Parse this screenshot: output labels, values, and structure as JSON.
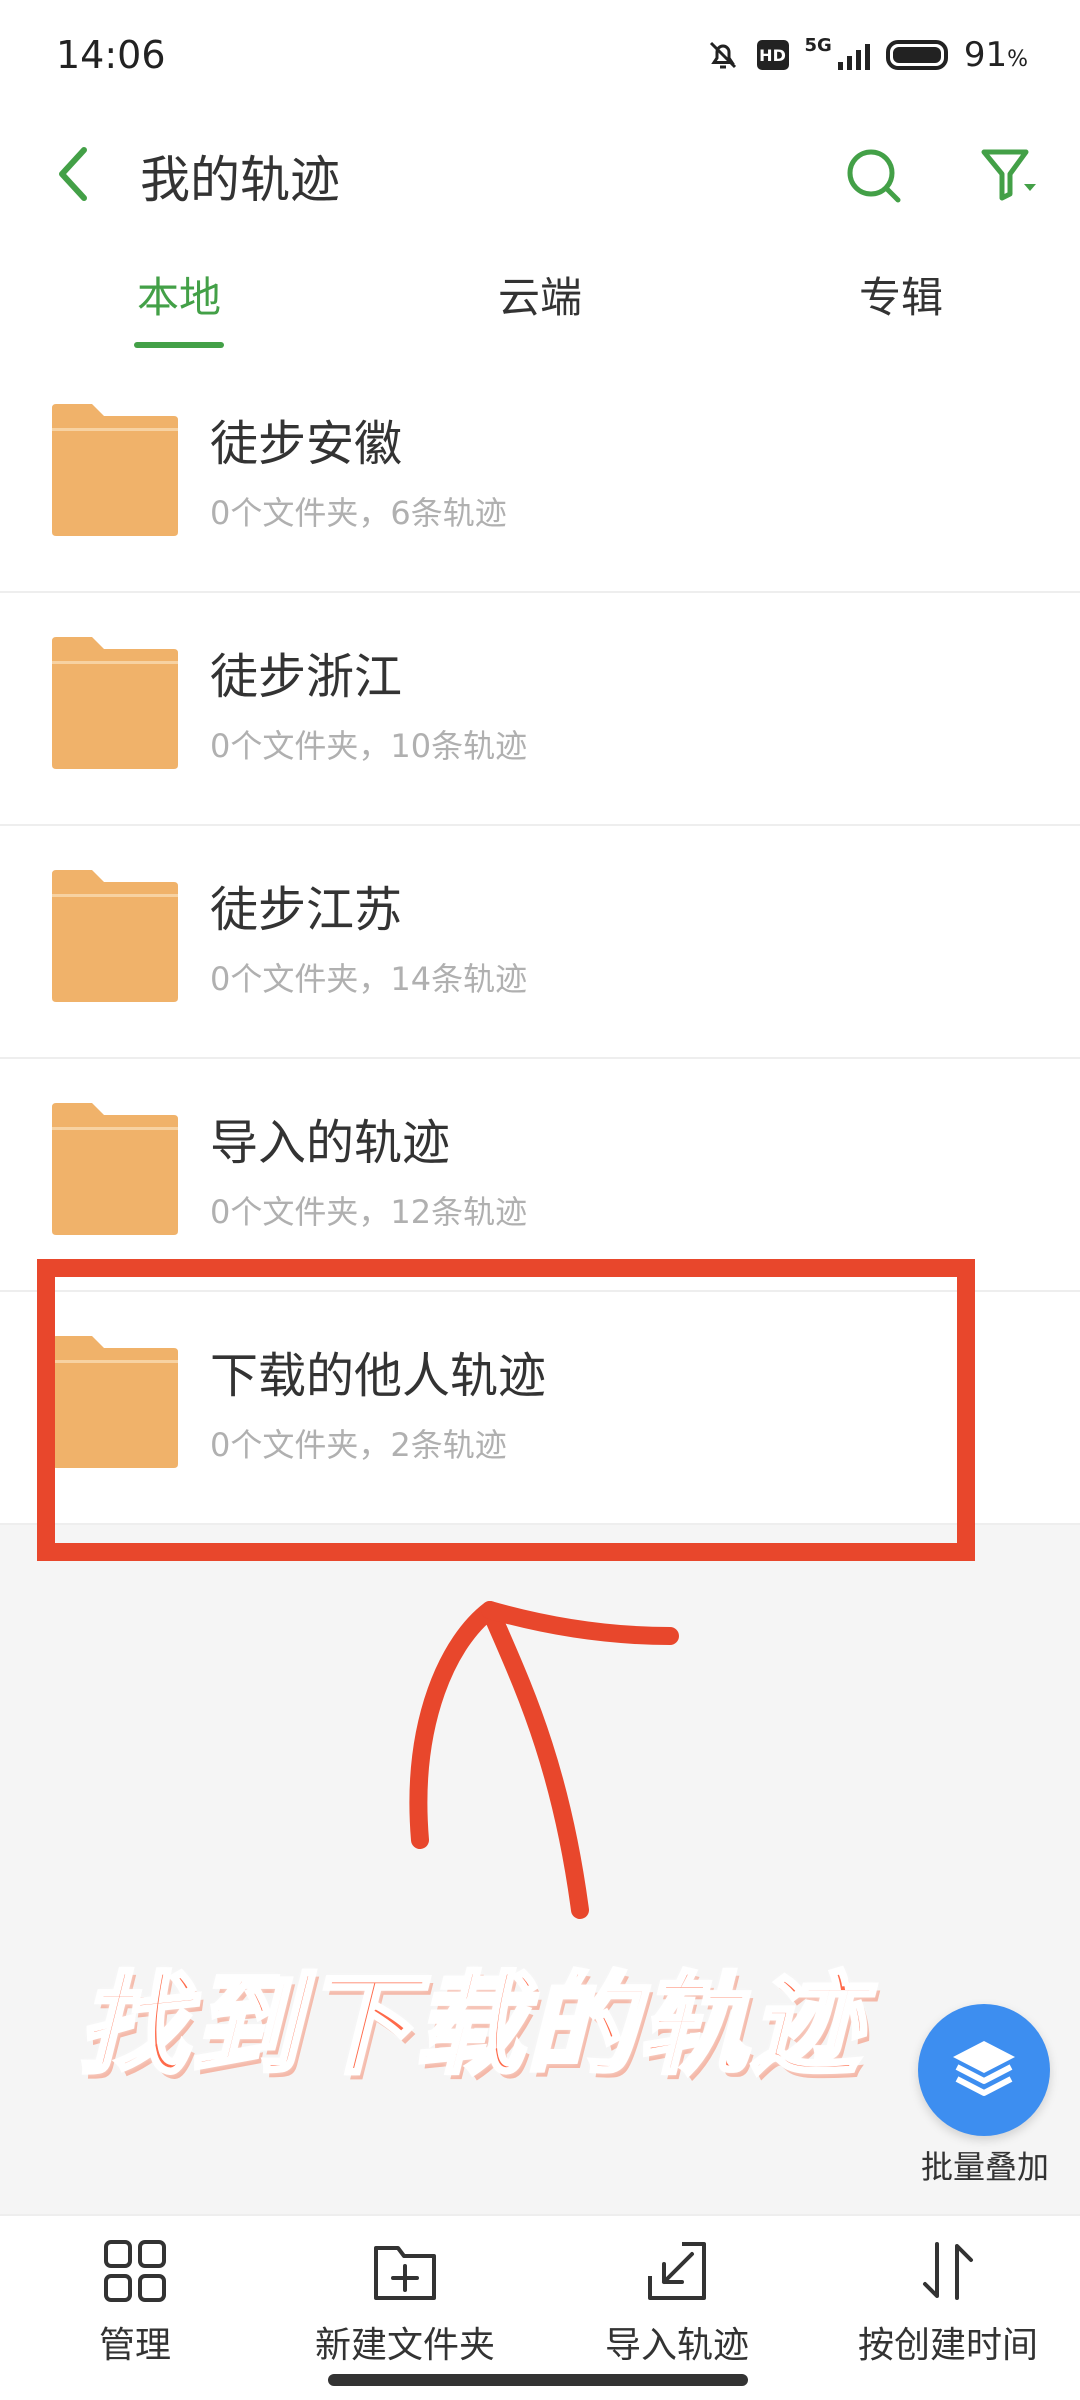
{
  "status_bar": {
    "time": "14:06",
    "network": "5G",
    "hd": "HD",
    "battery": "91",
    "battery_unit": "%"
  },
  "header": {
    "title": "我的轨迹",
    "back_icon": "chevron-left-icon",
    "search_icon": "search-icon",
    "filter_icon": "filter-icon"
  },
  "tabs": [
    {
      "label": "本地",
      "active": true
    },
    {
      "label": "云端",
      "active": false
    },
    {
      "label": "专辑",
      "active": false
    }
  ],
  "folders": [
    {
      "name": "徒步安徽",
      "meta": "0个文件夹，6条轨迹"
    },
    {
      "name": "徒步浙江",
      "meta": "0个文件夹，10条轨迹"
    },
    {
      "name": "徒步江苏",
      "meta": "0个文件夹，14条轨迹"
    },
    {
      "name": "导入的轨迹",
      "meta": "0个文件夹，12条轨迹"
    },
    {
      "name": "下载的他人轨迹",
      "meta": "0个文件夹，2条轨迹"
    }
  ],
  "annotation": {
    "text": "找到下载的轨迹"
  },
  "fab": {
    "label": "批量叠加",
    "icon": "layers-icon"
  },
  "toolbar": [
    {
      "label": "管理",
      "icon": "grid-icon"
    },
    {
      "label": "新建文件夹",
      "icon": "new-folder-icon"
    },
    {
      "label": "导入轨迹",
      "icon": "import-icon"
    },
    {
      "label": "按创建时间",
      "icon": "sort-icon"
    }
  ],
  "colors": {
    "accent": "#43a047",
    "folder": "#f0b26a",
    "annotation": "#e8472c",
    "fab": "#3d8ef0"
  }
}
